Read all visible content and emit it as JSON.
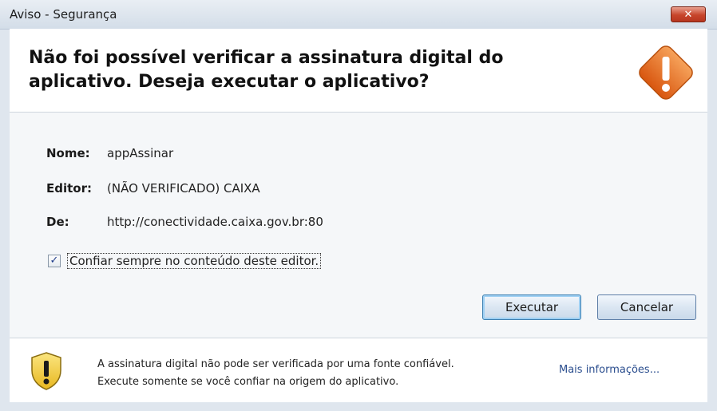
{
  "window": {
    "title": "Aviso - Segurança",
    "close_label": "✕"
  },
  "header": {
    "headline": "Não foi possível verificar a assinatura digital do aplicativo.  Deseja executar o aplicativo?",
    "icon": "warning-diamond-icon"
  },
  "details": {
    "name_label": "Nome:",
    "name_value": "appAssinar",
    "publisher_label": "Editor:",
    "publisher_value": "(NÃO VERIFICADO) CAIXA",
    "from_label": "De:",
    "from_value": "http://conectividade.caixa.gov.br:80"
  },
  "trust_checkbox": {
    "label": "Confiar sempre no conteúdo deste editor.",
    "checked": true,
    "check_mark": "✓"
  },
  "buttons": {
    "run": "Executar",
    "cancel": "Cancelar"
  },
  "footer": {
    "icon": "warning-shield-icon",
    "line1": "A assinatura digital não pode ser verificada por uma fonte confiável.",
    "line2": "Execute somente se você confiar na origem do aplicativo.",
    "more_info": "Mais informações..."
  },
  "colors": {
    "warning_orange": "#e8731d",
    "shield_yellow": "#f2cf3a",
    "link_blue": "#2a4d8e"
  }
}
